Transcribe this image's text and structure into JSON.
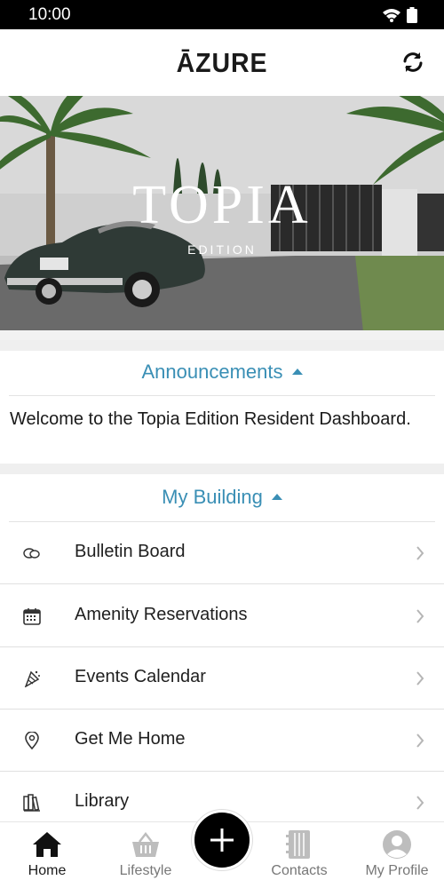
{
  "status_bar": {
    "time": "10:00",
    "wifi_icon": "wifi-icon",
    "battery_icon": "battery-icon"
  },
  "header": {
    "brand": "ĀZURE",
    "refresh_icon": "refresh-icon"
  },
  "hero": {
    "title": "TOPIA",
    "subtitle": "EDITION"
  },
  "announcements": {
    "title": "Announcements",
    "expanded": true,
    "text": "Welcome to the Topia Edition Resident Dashboard."
  },
  "my_building": {
    "title": "My Building",
    "expanded": true,
    "items": [
      {
        "label": "Bulletin Board",
        "icon": "chat-bubbles-icon"
      },
      {
        "label": "Amenity Reservations",
        "icon": "calendar-icon"
      },
      {
        "label": "Events Calendar",
        "icon": "party-icon"
      },
      {
        "label": "Get Me Home",
        "icon": "location-pin-icon"
      },
      {
        "label": "Library",
        "icon": "books-icon"
      }
    ]
  },
  "bottom_nav": {
    "items": [
      {
        "label": "Home",
        "icon": "home-icon",
        "active": true
      },
      {
        "label": "Lifestyle",
        "icon": "basket-icon",
        "active": false
      },
      {
        "label": "Contacts",
        "icon": "address-book-icon",
        "active": false
      },
      {
        "label": "My Profile",
        "icon": "user-icon",
        "active": false
      }
    ],
    "add_icon": "plus-icon"
  },
  "colors": {
    "accent": "#3a8fb5",
    "nav_inactive": "#777777",
    "separator": "#efefef"
  }
}
